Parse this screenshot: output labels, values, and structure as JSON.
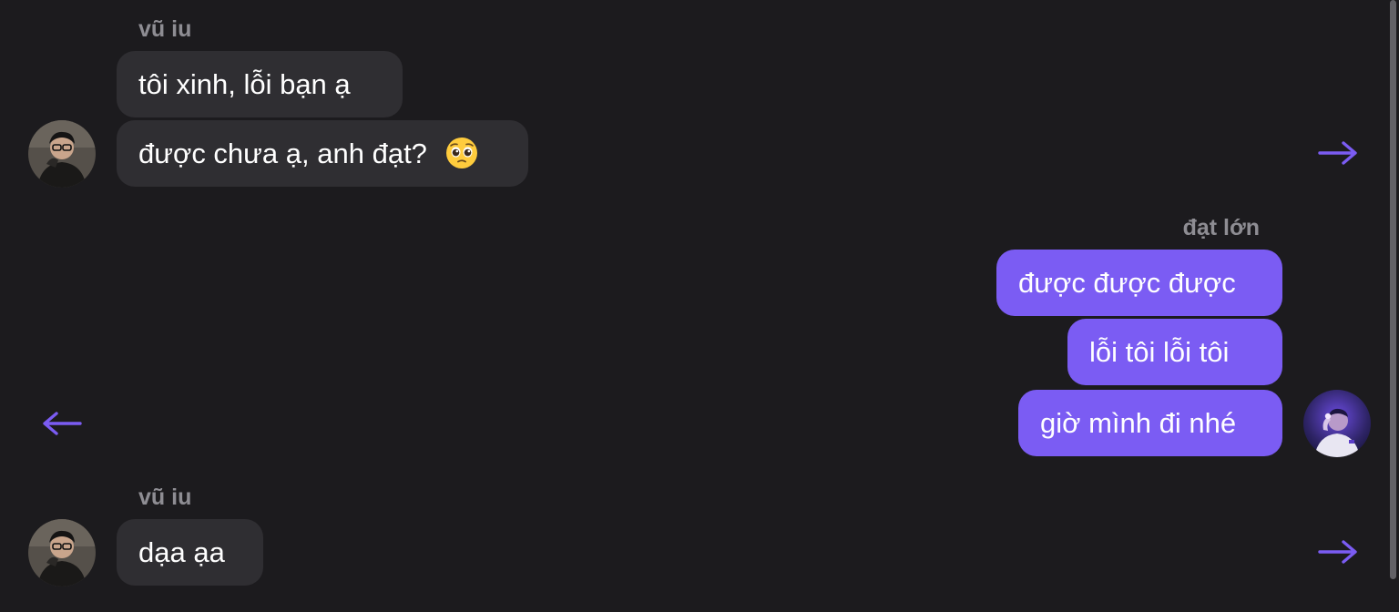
{
  "colors": {
    "background": "#1c1b1e",
    "incoming_bubble": "#2f2e32",
    "outgoing_bubble": "#7b5cf3",
    "accent": "#7b5cf3",
    "sender_name": "#8e8d93"
  },
  "groups": [
    {
      "direction": "incoming",
      "sender": "vũ iu",
      "messages": [
        {
          "text": "tôi xinh, lỗi bạn ạ"
        },
        {
          "text": "được chưa ạ, anh đạt?",
          "emoji": "pleading-face-icon"
        }
      ],
      "action_icon": "arrow-right-icon"
    },
    {
      "direction": "outgoing",
      "sender": "đạt lớn",
      "messages": [
        {
          "text": "được được được"
        },
        {
          "text": "lỗi tôi lỗi tôi"
        },
        {
          "text": "giờ mình đi nhé"
        }
      ],
      "action_icon": "arrow-left-icon"
    },
    {
      "direction": "incoming",
      "sender": "vũ iu",
      "messages": [
        {
          "text": "dạa ạa"
        }
      ],
      "action_icon": "arrow-right-icon"
    }
  ]
}
